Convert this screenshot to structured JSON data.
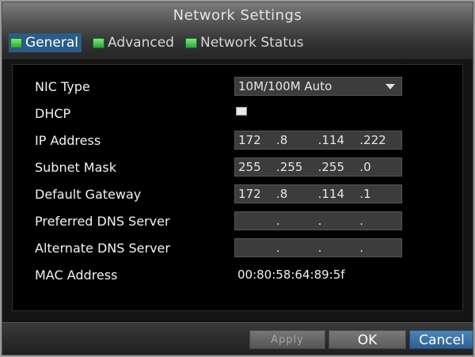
{
  "window": {
    "title": "Network Settings"
  },
  "tabs": [
    {
      "label": "General",
      "icon": "green-tab-icon",
      "active": true
    },
    {
      "label": "Advanced",
      "icon": "green-tab-icon",
      "active": false
    },
    {
      "label": "Network Status",
      "icon": "green-tab-icon",
      "active": false
    }
  ],
  "form": {
    "nic_type": {
      "label": "NIC Type",
      "value": "10M/100M Auto"
    },
    "dhcp": {
      "label": "DHCP",
      "checked": false
    },
    "ip_address": {
      "label": "IP Address",
      "octets": [
        "172",
        "8",
        "114",
        "222"
      ]
    },
    "subnet_mask": {
      "label": "Subnet Mask",
      "octets": [
        "255",
        "255",
        "255",
        "0"
      ]
    },
    "default_gateway": {
      "label": "Default Gateway",
      "octets": [
        "172",
        "8",
        "114",
        "1"
      ]
    },
    "preferred_dns": {
      "label": "Preferred DNS Server",
      "octets": [
        "",
        "",
        "",
        ""
      ]
    },
    "alternate_dns": {
      "label": "Alternate DNS Server",
      "octets": [
        "",
        "",
        "",
        ""
      ]
    },
    "mac_address": {
      "label": "MAC Address",
      "value": "00:80:58:64:89:5f"
    }
  },
  "buttons": {
    "apply": "Apply",
    "ok": "OK",
    "cancel": "Cancel"
  },
  "colors": {
    "active_tab": "#2a5c88",
    "cancel_button": "#2b5f92",
    "tab_icon": "#2da33a"
  }
}
